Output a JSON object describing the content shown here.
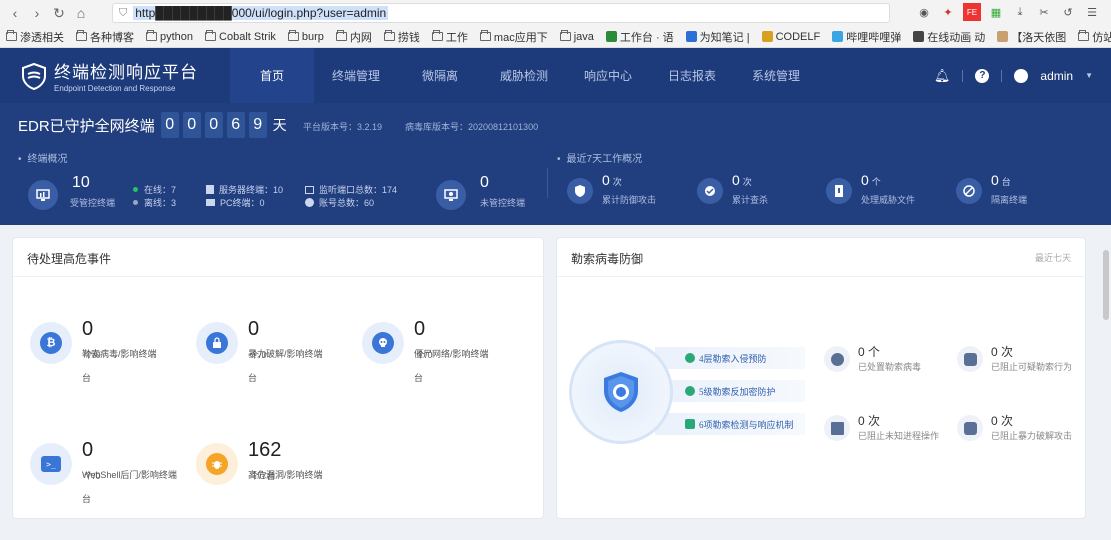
{
  "browser": {
    "url": "http█████████000/ui/login.php?user=admin",
    "bookmarks": [
      "渗透相关",
      "各种博客",
      "python",
      "Cobalt Strik",
      "burp",
      "内网",
      "捞钱",
      "工作",
      "mac应用下",
      "java",
      "工作台 · 语",
      "为知笔记 |",
      "CODELF",
      "哔哩哔哩弹",
      "在线动画 动",
      "【洛天依图",
      "仿站工具箱"
    ]
  },
  "header": {
    "title": "终端检测响应平台",
    "subtitle": "Endpoint Detection and Response",
    "nav": [
      "首页",
      "终端管理",
      "微隔离",
      "威胁检测",
      "响应中心",
      "日志报表",
      "系统管理"
    ],
    "user": "admin"
  },
  "guard": {
    "prefix": "EDR已守护全网终端",
    "digits": [
      "0",
      "0",
      "0",
      "6",
      "9"
    ],
    "unit": "天",
    "platform_version": "平台版本号：3.2.19",
    "virus_version": "病毒库版本号：20200812101300"
  },
  "terminal_overview": {
    "title": "终端概况",
    "managed_num": "10",
    "managed_lbl": "受管控终端",
    "online": "在线：7",
    "offline": "离线：3",
    "server": "服务器终端：10",
    "pc": "PC终端：0",
    "ports": "监听端口总数：174",
    "accounts": "账号总数：60",
    "unmanaged_num": "0",
    "unmanaged_lbl": "未管控终端"
  },
  "week_overview": {
    "title": "最近7天工作概况",
    "items": [
      {
        "num": "0",
        "unit": "次",
        "label": "累计防御攻击"
      },
      {
        "num": "0",
        "unit": "次",
        "label": "累计查杀"
      },
      {
        "num": "0",
        "unit": "个",
        "label": "处理威胁文件"
      },
      {
        "num": "0",
        "unit": "台",
        "label": "隔离终端"
      }
    ]
  },
  "pending": {
    "title": "待处理高危事件",
    "events": [
      {
        "num": "0",
        "unit": "个/0台",
        "label": "勒索病毒/影响终端"
      },
      {
        "num": "0",
        "unit": "个/0台",
        "label": "暴力破解/影响终端"
      },
      {
        "num": "0",
        "unit": "个/0台",
        "label": "僵尸网络/影响终端"
      },
      {
        "num": "0",
        "unit": "个/0台",
        "label": "WebShell后门/影响终端"
      },
      {
        "num": "162",
        "unit": "个/7台",
        "label": "高危漏洞/影响终端"
      }
    ]
  },
  "ransom": {
    "title": "勒索病毒防御",
    "corner": "最近七天",
    "layers": [
      "4层勒索入侵预防",
      "5级勒索反加密防护",
      "6项勒索检测与响应机制"
    ],
    "stats": [
      {
        "num": "0 个",
        "label": "已处置勒索病毒"
      },
      {
        "num": "0 次",
        "label": "已阻止可疑勒索行为"
      },
      {
        "num": "0 次",
        "label": "已阻止未知进程操作"
      },
      {
        "num": "0 次",
        "label": "已阻止暴力破解攻击"
      }
    ]
  }
}
